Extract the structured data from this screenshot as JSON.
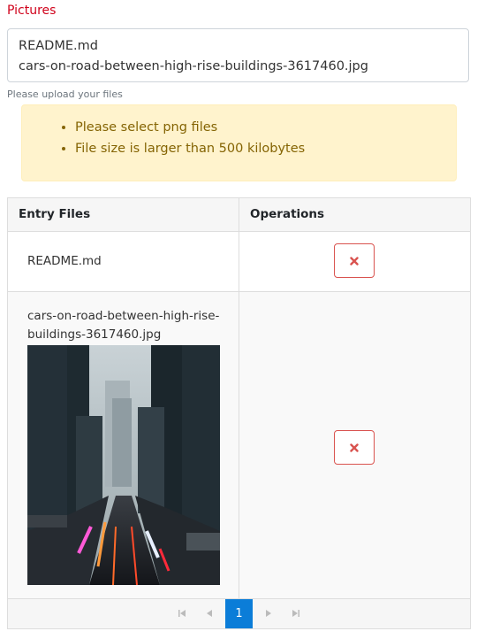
{
  "field": {
    "label": "Pictures",
    "files": [
      "README.md",
      "cars-on-road-between-high-rise-buildings-3617460.jpg"
    ],
    "helper": "Please upload your files"
  },
  "alert": {
    "messages": [
      "Please select png files",
      "File size is larger than 500 kilobytes"
    ]
  },
  "grid": {
    "headers": {
      "files": "Entry Files",
      "operations": "Operations"
    },
    "rows": [
      {
        "name": "README.md"
      },
      {
        "name_line1": "cars-on-road-between-high-rise-",
        "name_line2": "buildings-3617460.jpg"
      }
    ]
  },
  "pager": {
    "current_page": "1"
  },
  "colors": {
    "label": "#d0021b",
    "alert_bg": "#fff3cd",
    "alert_text": "#856404",
    "delete": "#d9534f",
    "pager_active": "#0b7dd8"
  },
  "icons": [
    "delete-x-icon",
    "first-page-icon",
    "prev-page-icon",
    "next-page-icon",
    "last-page-icon"
  ]
}
